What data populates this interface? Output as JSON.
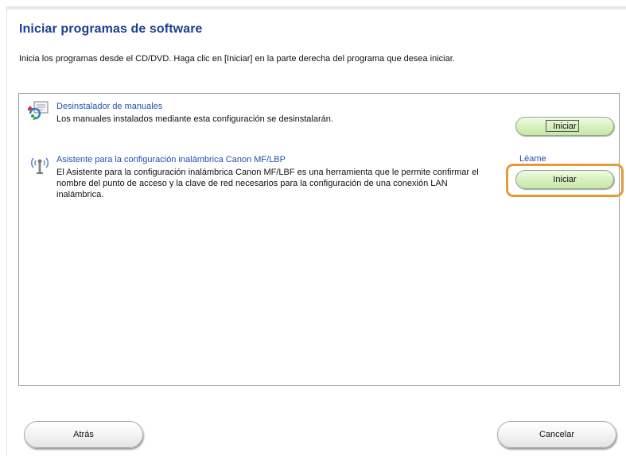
{
  "page": {
    "title": "Iniciar programas de software",
    "instruction": "Inicia los programas desde el CD/DVD. Haga clic en [Iniciar] en la parte derecha del programa que desea iniciar."
  },
  "programs": [
    {
      "name": "Desinstalador de manuales",
      "description": "Los manuales instalados mediante esta configuración se desinstalarán.",
      "icon": "manual-uninstaller-icon",
      "launch_label": "Iniciar"
    },
    {
      "name": "Asistente para la configuración inalámbrica Canon MF/LBP",
      "description": "El Asistente para la configuración inalámbrica Canon MF/LBF es una herramienta que le permite confirmar el nombre del punto de acceso y la clave de red necesarios para la configuración de una conexión LAN inalámbrica.",
      "icon": "wireless-antenna-icon",
      "readme_label": "Léame",
      "launch_label": "Iniciar"
    }
  ],
  "footer": {
    "back_label": "Atrás",
    "cancel_label": "Cancelar"
  },
  "colors": {
    "title": "#1b3f8f",
    "link": "#1f4fb5",
    "launch_button": "#d8f0bf",
    "highlight": "#e59a3a"
  }
}
